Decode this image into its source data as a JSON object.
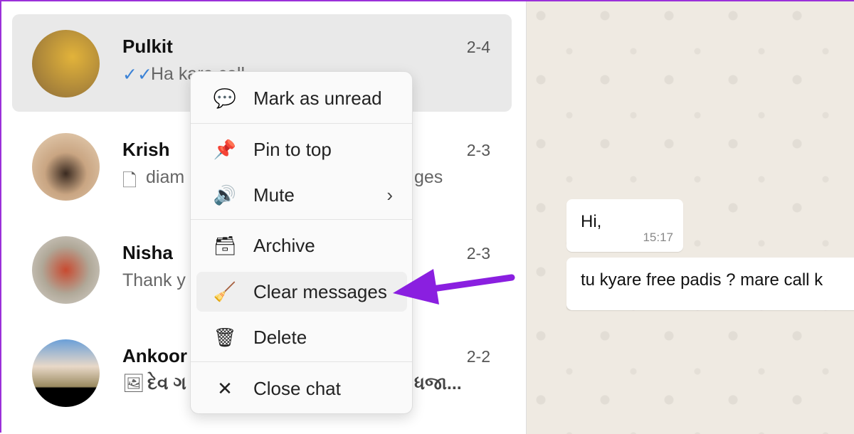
{
  "chats": [
    {
      "name": "Pulkit",
      "date": "2-4",
      "preview_left": "Ha kara call",
      "preview_right": "",
      "icon": "double-check-icon",
      "avatar_color": "#c9a24a"
    },
    {
      "name": "Krish",
      "date": "2-3",
      "preview_left": "diam",
      "preview_right": "ges",
      "icon": "document-icon",
      "avatar_color": "#b9966e"
    },
    {
      "name": "Nisha",
      "date": "2-3",
      "preview_left": "Thank y",
      "preview_right": "",
      "icon": "",
      "avatar_color": "#a8a8a0"
    },
    {
      "name": "Ankoor",
      "date": "2-2",
      "preview_left": "દેવ ગ",
      "preview_right": "ધજા...",
      "icon": "image-icon",
      "avatar_color": "#6a8fb8"
    }
  ],
  "context_menu": {
    "items": [
      {
        "label": "Mark as unread",
        "icon": "mark-unread-icon"
      },
      {
        "label": "Pin to top",
        "icon": "pin-icon"
      },
      {
        "label": "Mute",
        "icon": "speaker-icon"
      },
      {
        "label": "Archive",
        "icon": "archive-icon"
      },
      {
        "label": "Clear messages",
        "icon": "broom-icon"
      },
      {
        "label": "Delete",
        "icon": "trash-icon"
      },
      {
        "label": "Close chat",
        "icon": "close-icon"
      }
    ]
  },
  "messages": [
    {
      "text": "Hi,",
      "time": "15:17"
    },
    {
      "text": "tu kyare free padis ? mare call k"
    }
  ],
  "colors": {
    "annotation_arrow": "#8a1fe0",
    "read_check": "#3b82d6"
  }
}
